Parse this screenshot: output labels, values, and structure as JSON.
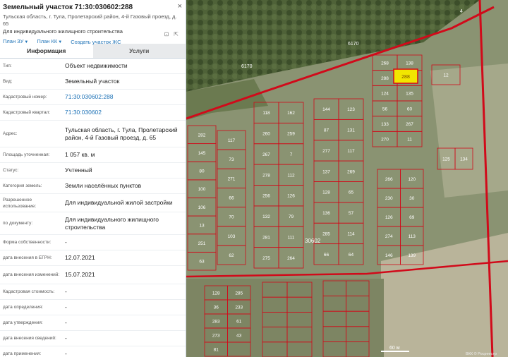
{
  "header": {
    "title": "Земельный участок 71:30:030602:288",
    "close": "×",
    "address": "Тульская область, г. Тула, Пролетарский район, 4-й Газовый проезд, д. 65",
    "purpose": "Для индивидуального жилищного строительства",
    "links": [
      {
        "label": "План ЗУ"
      },
      {
        "label": "План КК"
      },
      {
        "label": "Создать участок ЖС"
      }
    ]
  },
  "tabs": [
    {
      "label": "Информация",
      "active": true
    },
    {
      "label": "Услуги",
      "active": false
    }
  ],
  "rows": [
    {
      "key": "Тип:",
      "value": "Объект недвижимости"
    },
    {
      "key": "Вид:",
      "value": "Земельный участок"
    },
    {
      "key": "Кадастровый номер:",
      "value": "71:30:030602:288",
      "link": true
    },
    {
      "key": "Кадастровый квартал:",
      "value": "71:30:030602",
      "link": true
    },
    {
      "key": "Адрес:",
      "value": "Тульская область, г. Тула, Пролетарский район, 4-й Газовый проезд, д. 65"
    },
    {
      "key": "Площадь уточненная:",
      "value": "1 057 кв. м"
    },
    {
      "key": "Статус:",
      "value": "Учтенный"
    },
    {
      "key": "Категория земель:",
      "value": "Земли населённых пунктов"
    },
    {
      "key": "Разрешенное использование:",
      "value": "Для индивидуальной жилой застройки"
    },
    {
      "key": "по документу:",
      "value": "Для индивидуального жилищного строительства"
    },
    {
      "key": "Форма собственности:",
      "value": "-"
    },
    {
      "key": "дата внесения в ЕГРН:",
      "value": "12.07.2021"
    },
    {
      "key": "дата внесения изменений:",
      "value": "15.07.2021"
    },
    {
      "key": "Кадастровая стоимость:",
      "value": "-"
    },
    {
      "key": "дата определения:",
      "value": "-"
    },
    {
      "key": "дата утверждения:",
      "value": "-"
    },
    {
      "key": "дата внесения сведений:",
      "value": "-"
    },
    {
      "key": "дата применения:",
      "value": "-"
    }
  ],
  "map": {
    "selected_parcel": "288",
    "quarter_label": "30602",
    "scale_label": "60 м",
    "copyright": "ВКК © Росреестр",
    "road_labels": [
      "6170",
      "6170",
      "4"
    ],
    "parcels": [
      "268",
      "138",
      "288",
      "284",
      "124",
      "135",
      "56",
      "60",
      "133",
      "267",
      "270",
      "11",
      "12",
      "118",
      "162",
      "260",
      "259",
      "267",
      "7",
      "278",
      "112",
      "256",
      "126",
      "132",
      "79",
      "281",
      "111",
      "275",
      "264",
      "144",
      "123",
      "87",
      "131",
      "277",
      "117",
      "137",
      "269",
      "128",
      "65",
      "136",
      "57",
      "285",
      "114",
      "66",
      "64",
      "282",
      "145",
      "80",
      "100",
      "106",
      "13",
      "251",
      "63",
      "117",
      "73",
      "271",
      "66",
      "70",
      "103",
      "62",
      "266",
      "120",
      "230",
      "30",
      "126",
      "69",
      "274",
      "113",
      "146",
      "139",
      "125",
      "134",
      "128",
      "285",
      "36",
      "233",
      "283",
      "61",
      "273",
      "43",
      "81"
    ]
  },
  "colors": {
    "selected": "#f2e600",
    "boundary": "#d10a1a",
    "link": "#1f73b7"
  }
}
